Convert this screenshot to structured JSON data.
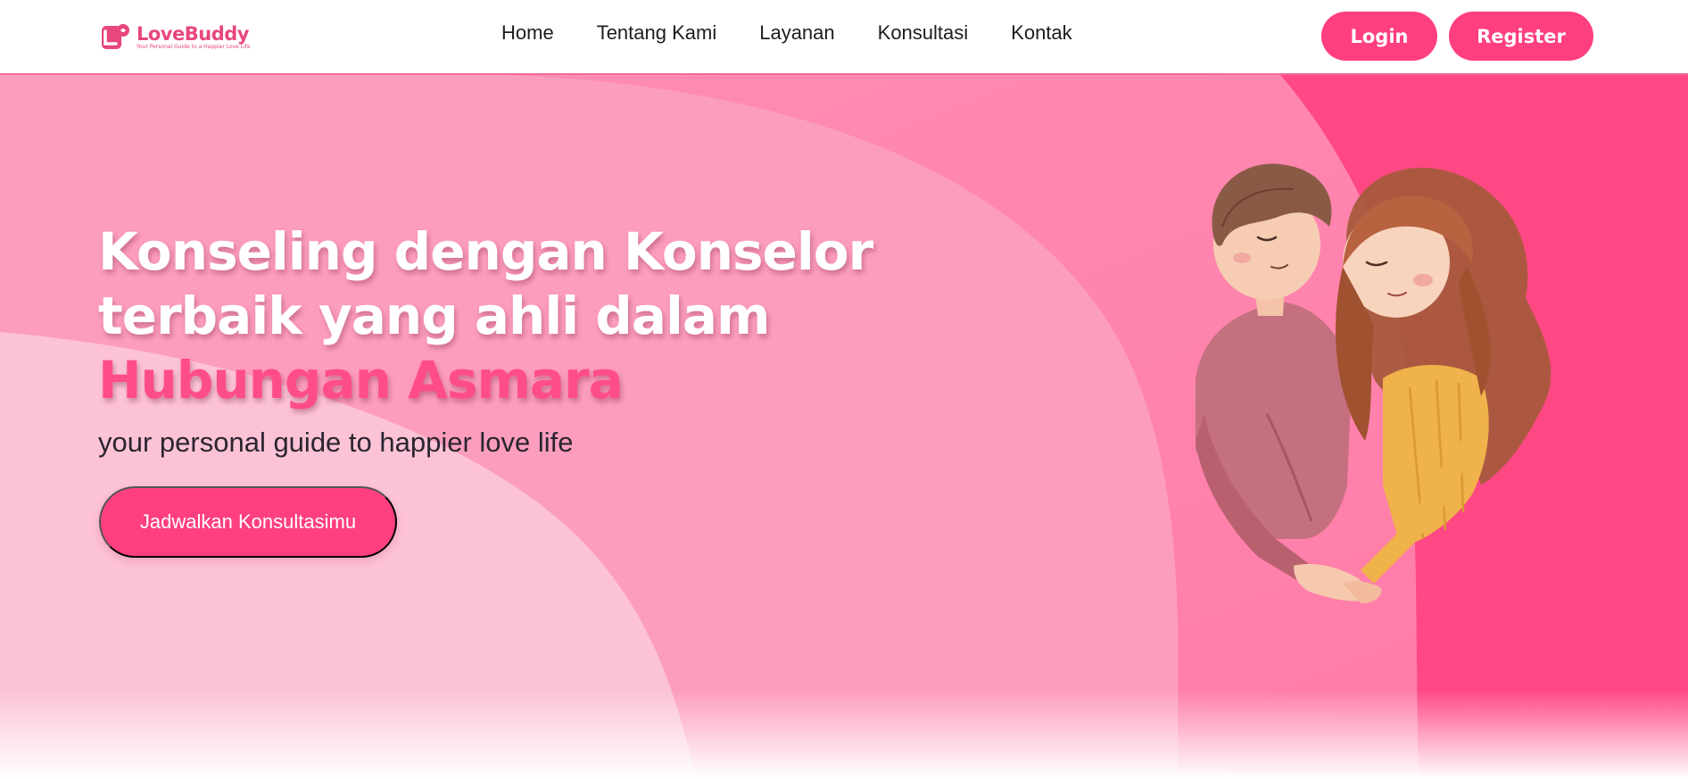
{
  "brand": {
    "name": "LoveBuddy",
    "tagline": "Your Personal Guide to a Happier Love Life",
    "logo_icon": "heart-chat-icon"
  },
  "nav": {
    "links": [
      {
        "label": "Home"
      },
      {
        "label": "Tentang Kami"
      },
      {
        "label": "Layanan"
      },
      {
        "label": "Konsultasi"
      },
      {
        "label": "Kontak"
      }
    ],
    "login_label": "Login",
    "register_label": "Register"
  },
  "hero": {
    "title_line1": "Konseling dengan Konselor",
    "title_line2": "terbaik yang ahli dalam",
    "title_highlight": "Hubungan Asmara",
    "subtitle": "your personal guide to happier love life",
    "cta_label": "Jadwalkan Konsultasimu",
    "illustration": "couple-holding-hands-illustration"
  },
  "colors": {
    "accent": "#ff3f80",
    "brand": "#e8467f",
    "hero_light": "#fcc4d7",
    "hero_mid": "#fb9cbb",
    "hero_deep": "#ff4884",
    "text_dark": "#1d1d1d"
  }
}
